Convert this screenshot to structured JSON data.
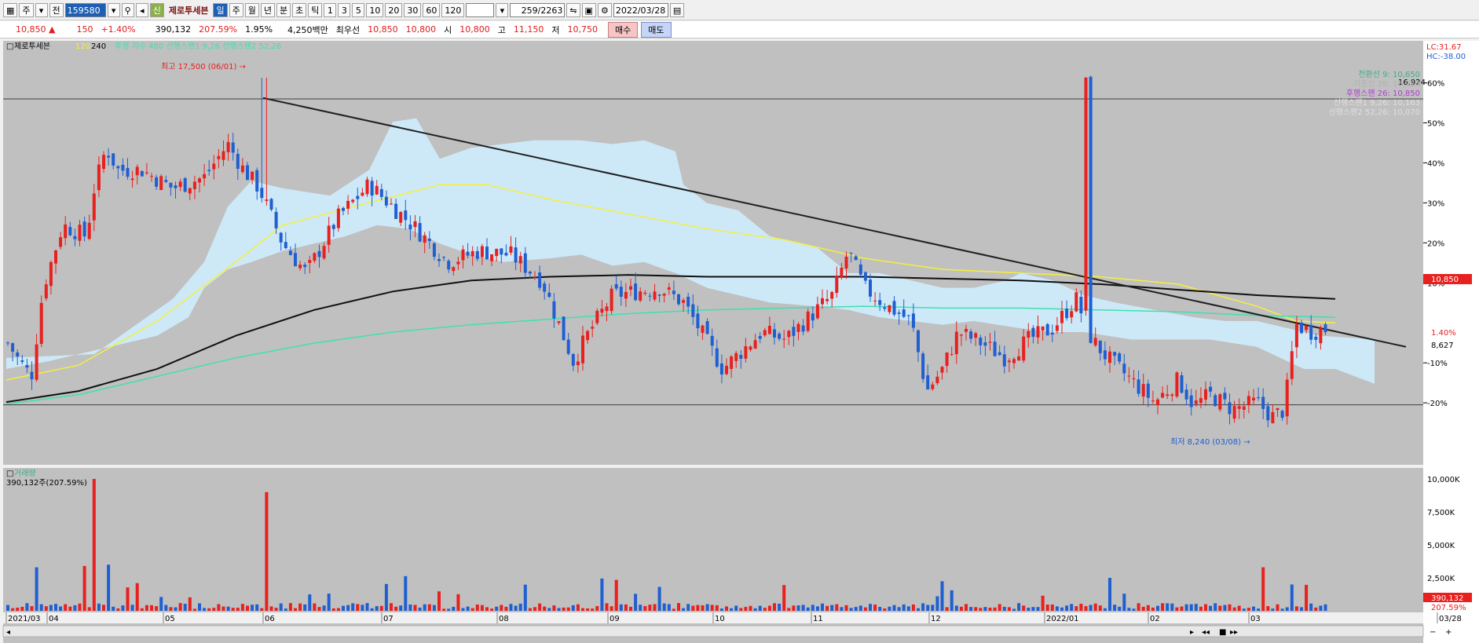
{
  "toolbar": {
    "period_prefix": "주",
    "prev_label": "전",
    "stock_code": "159580",
    "stock_badge": "신",
    "stock_name": "제로투세븐",
    "periods": [
      "일",
      "주",
      "월",
      "년",
      "분",
      "초",
      "틱"
    ],
    "active_period": "일",
    "minute_options": [
      "1",
      "3",
      "5",
      "10",
      "20",
      "30",
      "60",
      "120"
    ],
    "page_counter": "259/2263",
    "date_value": "2022/03/28"
  },
  "quote": {
    "price": "10,850 ▲",
    "change": "150",
    "change_pct": "+1.40%",
    "volume": "390,132",
    "volume_pct": "207.59%",
    "turnover_pct": "1.95%",
    "amount": "4,250백만",
    "pref_label": "최우선",
    "ask": "10,850",
    "bid": "10,800",
    "open_label": "시",
    "open": "10,800",
    "high_label": "고",
    "high": "11,150",
    "low_label": "저",
    "low": "10,750",
    "buy_label": "매수",
    "sell_label": "매도"
  },
  "price_panel": {
    "legend_name": "제로투세븐",
    "legend_ma": [
      "120",
      "240"
    ],
    "legend_rest": "후행 지수 480  선행스팬1 9,26  선행스팬2 52,26",
    "high_annotation": "최고 17,500 (06/01) →",
    "low_annotation": "최저 8,240 (03/08) →",
    "lc_label": "LC:31.67",
    "hc_label": "HC:-38.00",
    "pct_ticks": [
      "60%",
      "50%",
      "40%",
      "30%",
      "20%",
      "10%",
      "1.40%",
      "-10%",
      "-20%"
    ],
    "current_price_tag": "10,850",
    "support_value": "8,627",
    "resist_value": "16,924",
    "ichimoku_labels": [
      "전환선 9: 10,650",
      "기준선 26: 16,924",
      "후행스팬 26: 10,850",
      "선행스팬1 9,26: 10,163",
      "선행스팬2 52,26: 10,070"
    ]
  },
  "volume_panel": {
    "title": "거래량",
    "summary": "390,132주(207.59%)",
    "ticks": [
      "10,000K",
      "7,500K",
      "5,000K",
      "2,500K"
    ],
    "current_tag": "390,132",
    "current_pct": "207.59%"
  },
  "x_axis_labels": [
    "2021/03",
    "04",
    "05",
    "06",
    "07",
    "08",
    "09",
    "10",
    "11",
    "12",
    "2022/01",
    "02",
    "03",
    "03/28"
  ],
  "colors": {
    "up": "#e8201e",
    "down": "#1f5fd1",
    "cloud": "#cde9f8",
    "ma_yellow": "#f5ef3c",
    "ma_black": "#101010",
    "ma_teal": "#3fe0b0",
    "bg": "#c0c0c0"
  },
  "chart_data": {
    "type": "candlestick",
    "title": "제로투세븐",
    "x_range": [
      "2021/03",
      "2022/03/28"
    ],
    "price_annotations": {
      "high": 17500,
      "high_date": "06/01",
      "low": 8240,
      "low_date": "03/08",
      "current": 10850,
      "support_line": 8627,
      "resistance_level": 16924
    },
    "indicators": {
      "전환선 9": 10650,
      "기준선 26": 16924,
      "후행스팬 26": 10850,
      "선행스팬1 9,26": 10163,
      "선행스팬2 52,26": 10070
    },
    "volume_current": 390132,
    "volume_pct": 207.59,
    "volume_ylim": [
      0,
      10000000
    ],
    "grid": false,
    "legend": "top-left"
  }
}
